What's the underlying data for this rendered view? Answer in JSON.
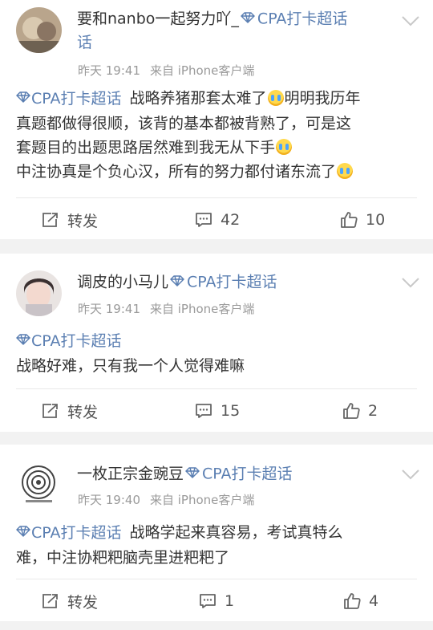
{
  "posts": [
    {
      "username": "要和nanbo一起努力吖_",
      "tag": "CPA打卡超话",
      "username_wrap": "话",
      "time": "昨天 19:41",
      "source": "来自 iPhone客户端",
      "lines": [
        {
          "tag": "CPA打卡超话",
          "text": "战略养猪那套太难了",
          "emoji": true,
          "text2": "明明我历年"
        },
        {
          "text": "真题都做得很顺，该背的基本都被背熟了，可是这"
        },
        {
          "text": "套题目的出题思路居然难到我无从下手",
          "emoji": true
        },
        {
          "text": "中注协真是个负心汉，所有的努力都付诸东流了",
          "emoji": true
        }
      ],
      "repost_label": "转发",
      "comment_count": "42",
      "like_count": "10"
    },
    {
      "username": "调皮的小马儿",
      "tag": "CPA打卡超话",
      "time": "昨天 19:41",
      "source": "来自 iPhone客户端",
      "lines": [
        {
          "tag": "CPA打卡超话",
          "text": ""
        },
        {
          "text": "战略好难，只有我一个人觉得难嘛"
        }
      ],
      "repost_label": "转发",
      "comment_count": "15",
      "like_count": "2"
    },
    {
      "username": "一枚正宗金豌豆",
      "tag": "CPA打卡超话",
      "time": "昨天 19:40",
      "source": "来自 iPhone客户端",
      "lines": [
        {
          "tag": "CPA打卡超话",
          "text": "战略学起来真容易，考试真特么"
        },
        {
          "text": "难，中注协粑粑脑壳里进粑粑了"
        }
      ],
      "repost_label": "转发",
      "comment_count": "1",
      "like_count": "4"
    }
  ],
  "colors": {
    "accent": "#5b7fb2",
    "muted": "#9a9a9a",
    "page_bg": "#f2f2f2"
  },
  "icons": [
    "diamond-icon",
    "chevron-down-icon",
    "repost-icon",
    "comment-icon",
    "like-icon"
  ]
}
